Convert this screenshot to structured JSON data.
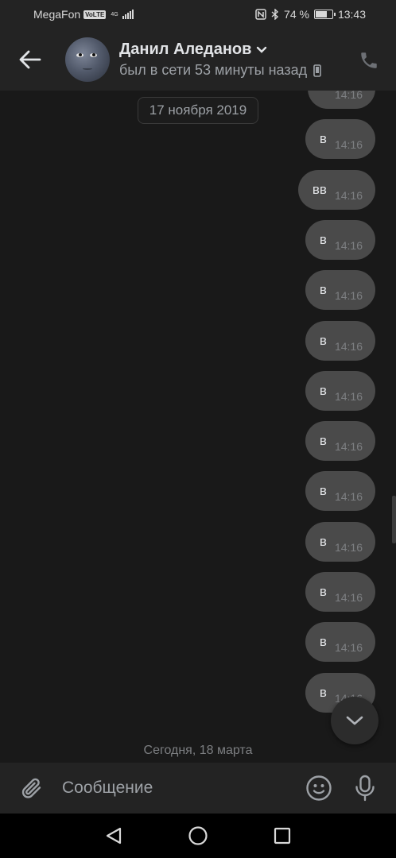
{
  "status_bar": {
    "carrier": "MegaFon",
    "volte": "VoLTE",
    "network": "4G",
    "battery_percent": "74 %",
    "battery_level": 0.74,
    "time": "13:43"
  },
  "header": {
    "contact_name": "Данил Аледанов",
    "last_seen": "был в сети 53 минуты назад",
    "icons": {
      "back": "arrow-left-icon",
      "dropdown": "chevron-down-icon",
      "device": "mobile-icon",
      "call": "phone-icon"
    }
  },
  "messages": {
    "date_separator": "17 ноября 2019",
    "items": [
      {
        "text": "·",
        "time": "14:16"
      },
      {
        "text": "в",
        "time": "14:16"
      },
      {
        "text": "вв",
        "time": "14:16"
      },
      {
        "text": "в",
        "time": "14:16"
      },
      {
        "text": "в",
        "time": "14:16"
      },
      {
        "text": "в",
        "time": "14:16"
      },
      {
        "text": "в",
        "time": "14:16"
      },
      {
        "text": "в",
        "time": "14:16"
      },
      {
        "text": "в",
        "time": "14:16"
      },
      {
        "text": "в",
        "time": "14:16"
      },
      {
        "text": "в",
        "time": "14:16"
      },
      {
        "text": "в",
        "time": "14:16"
      },
      {
        "text": "в",
        "time": "14:16"
      }
    ],
    "today_separator": "Сегодня, 18 марта"
  },
  "composer": {
    "placeholder": "Сообщение",
    "icons": {
      "attach": "paperclip-icon",
      "emoji": "smiley-icon",
      "mic": "microphone-icon"
    }
  },
  "navigation": {
    "icons": [
      "back-triangle-icon",
      "home-circle-icon",
      "recents-square-icon"
    ]
  },
  "colors": {
    "background": "#191919",
    "bar": "#232323",
    "bubble": "#4a4a4a",
    "text": "#e1e3e6",
    "muted": "#9da1a6"
  }
}
